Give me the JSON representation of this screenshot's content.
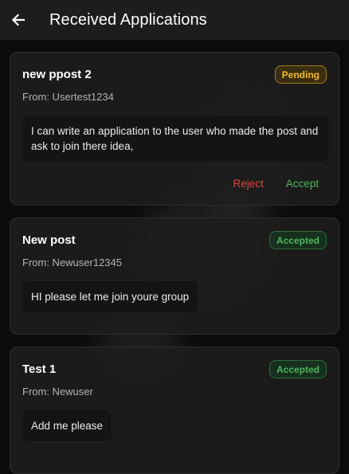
{
  "appbar": {
    "title": "Received Applications",
    "back_icon": "arrow-left-icon"
  },
  "applications": [
    {
      "title": "new ppost 2",
      "status": "Pending",
      "from": "From: Usertest1234",
      "message": "I can write an application to the user who made the post and ask to join there idea,",
      "actions": {
        "reject": "Reject",
        "accept": "Accept"
      }
    },
    {
      "title": "New post",
      "status": "Accepted",
      "from": "From: Newuser12345",
      "message": "HI please let me join youre group"
    },
    {
      "title": "Test 1",
      "status": "Accepted",
      "from": "From: Newuser",
      "message": "Add me please"
    }
  ],
  "colors": {
    "pending": "#f4b91c",
    "accepted": "#4fb45c",
    "reject": "#e0463c",
    "appbar": "#1d1d1d",
    "card": "#1e1e1e"
  }
}
